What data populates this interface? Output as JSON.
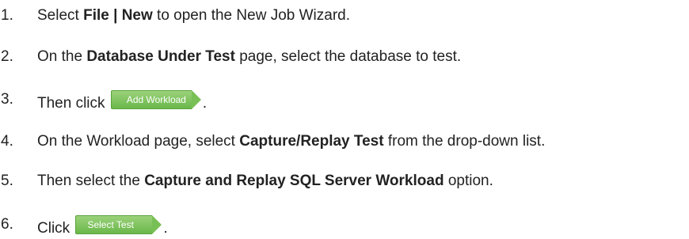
{
  "steps": [
    {
      "number": "1.",
      "parts": [
        "Select ",
        "File | New",
        " to open the New Job Wizard."
      ]
    },
    {
      "number": "2.",
      "parts": [
        "On the ",
        "Database Under Test",
        " page, select the database to test."
      ]
    },
    {
      "number": "3.",
      "before": "Then click",
      "button": "Add Workload",
      "after": "."
    },
    {
      "number": "4.",
      "parts": [
        "On the Workload page, select ",
        "Capture/Replay Test",
        " from the drop-down list."
      ]
    },
    {
      "number": "5.",
      "parts": [
        "Then select the ",
        "Capture and Replay SQL Server Workload",
        " option."
      ]
    },
    {
      "number": "6.",
      "before": "Click",
      "button": "Select Test",
      "after": "."
    }
  ],
  "colors": {
    "button_green": "#78c056",
    "text": "#222222"
  }
}
